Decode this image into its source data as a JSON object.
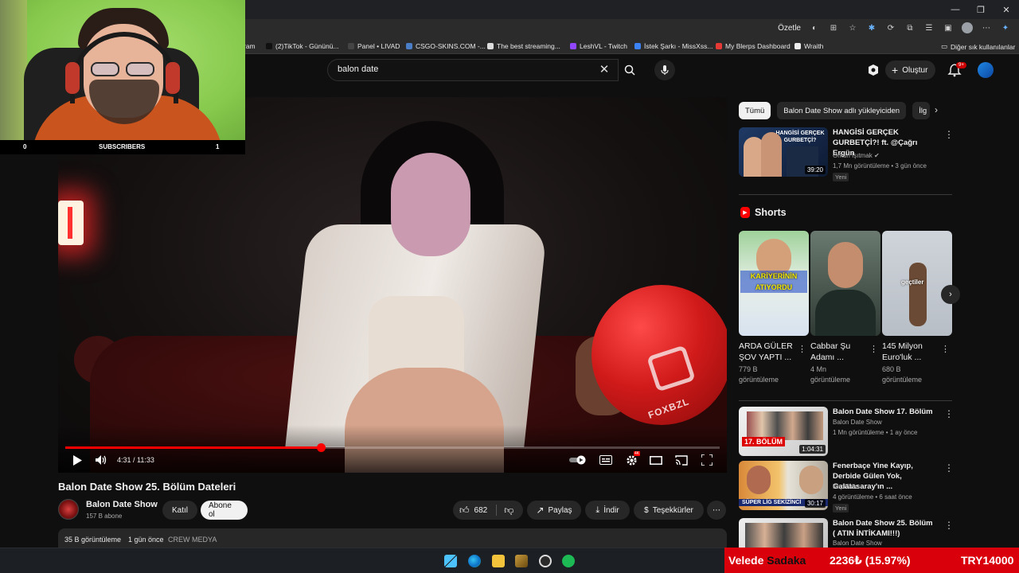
{
  "browser": {
    "summarize_label": "Özetle",
    "other_bookmarks": "Diğer sık kullanılanlar",
    "bookmarks": [
      {
        "label": "ram",
        "color": "#666666"
      },
      {
        "label": "(2)TikTok - Gününü...",
        "color": "#111111"
      },
      {
        "label": "Panel • LIVAD",
        "color": "#444444"
      },
      {
        "label": "CSGO-SKINS.COM -...",
        "color": "#4a7ec7"
      },
      {
        "label": "The best streaming...",
        "color": "#dddddd"
      },
      {
        "label": "LeshVL - Twitch",
        "color": "#9146ff"
      },
      {
        "label": "İstek Şarkı - MissXss...",
        "color": "#3b82f6"
      },
      {
        "label": "My Blerps Dashboard",
        "color": "#e53935"
      },
      {
        "label": "Wraith",
        "color": "#eeeeee"
      }
    ]
  },
  "header": {
    "search_query": "balon date",
    "create_label": "Oluştur",
    "notification_count": "9+"
  },
  "webcam": {
    "sub_left": "0",
    "sub_label": "SUBSCRIBERS",
    "sub_right": "1"
  },
  "player": {
    "current_time": "4:31",
    "duration": "11:33",
    "time_display": "4:31 / 11:33",
    "progress": 0.391,
    "balloon_text": "FOXBZL"
  },
  "video": {
    "title": "Balon Date Show 25. Bölüm Dateleri",
    "channel_name": "Balon Date Show",
    "channel_subs": "157 B abone",
    "join_label": "Katıl",
    "subscribe_label": "Abone ol",
    "likes": "682",
    "share_label": "Paylaş",
    "download_label": "İndir",
    "thanks_label": "Teşekkürler",
    "views": "35 B görüntüleme",
    "date": "1 gün önce",
    "tag": "CREW MEDYA"
  },
  "sidebar": {
    "chips": [
      "Tümü",
      "Balon Date Show adlı yükleyiciden",
      "İlg"
    ],
    "recommended": [
      {
        "title": "HANGİSİ GERÇEK GURBETÇİ?! ft. @Çağrı Ergün",
        "channel": "Orkun Işıtmak",
        "meta": "1,7 Mn görüntüleme • 3 gün önce",
        "badge": "Yeni",
        "duration": "39:20",
        "thumb_text": "HANGİSİ GERÇEK GURBETÇİ?"
      }
    ],
    "shorts_title": "Shorts",
    "shorts": [
      {
        "title": "ARDA GÜLER ŞOV YAPTI ...",
        "views": "779 B görüntüleme",
        "thumb_text": "KARİYERİNİN ATIYORDU"
      },
      {
        "title": "Cabbar Şu Adamı ...",
        "views": "4 Mn görüntüleme",
        "thumb_text": ""
      },
      {
        "title": "145 Milyon Euro'luk ...",
        "views": "680 B görüntüleme",
        "thumb_text": "geçtiler"
      }
    ],
    "more_videos": [
      {
        "title": "Balon Date Show 17. Bölüm",
        "channel": "Balon Date Show",
        "meta": "1 Mn görüntüleme • 1 ay önce",
        "badge": "",
        "duration": "1:04:31",
        "thumb_text": "17. BÖLÜM"
      },
      {
        "title": "Fenerbaçe Yine Kayıp, Derbide Gülen Yok, Galatasaray'ın ...",
        "channel": "KirpiTalks",
        "meta": "4 görüntüleme • 6 saat önce",
        "badge": "Yeni",
        "duration": "30:17",
        "thumb_text": "SÜPER LİG SEKİZİNCİ"
      },
      {
        "title": "Balon Date Show 25. Bölüm ( ATIN İNTİKAMI!!!)",
        "channel": "Balon Date Show",
        "meta": "",
        "badge": "",
        "duration": "",
        "thumb_text": ""
      }
    ]
  },
  "ticker": {
    "name_white": "Velede ",
    "name_black": "Sadaka",
    "change": "2236₺ (15.97%)",
    "price": "TRY14000"
  },
  "colors": {
    "accent_red": "#ff0000",
    "background": "#0f0f0f",
    "ticker_bg": "#d9000c"
  }
}
